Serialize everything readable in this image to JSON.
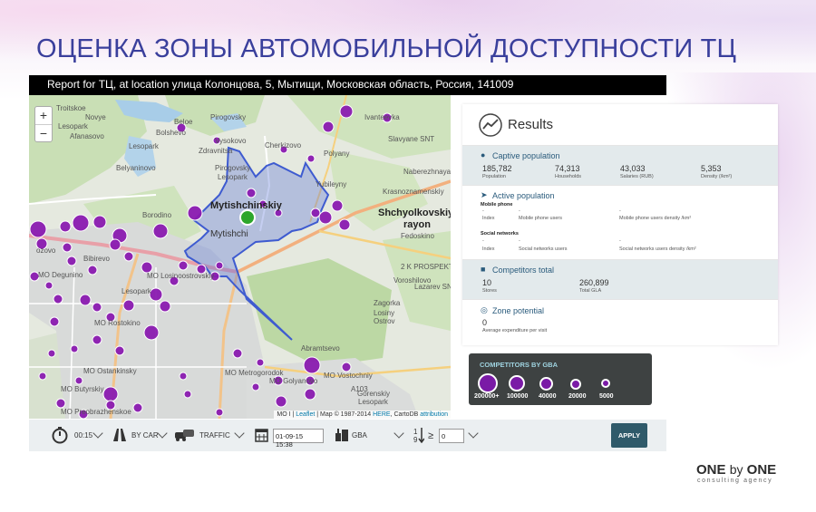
{
  "slide": {
    "title": "ОЦЕНКА ЗОНЫ АВТОМОБИЛЬНОЙ ДОСТУПНОСТИ ТЦ",
    "report": "Report for ТЦ, at location улица Колонцова, 5, Мытищи, Московская область, Россия, 141009",
    "brand": {
      "one_a": "ONE",
      "by": "by",
      "one_b": "ONE",
      "tagline": "consulting agency"
    }
  },
  "map": {
    "zoom_in": "+",
    "zoom_out": "−",
    "labels": {
      "troitskoe": "Troitskoe",
      "novye": "Novye",
      "lesopark1": "Lesopark",
      "afanasovo": "Afanasovo",
      "pirogovsky": "Pirogovsky",
      "beloe": "Beloe",
      "ivanteevka": "Ivanteevka",
      "bolshevo": "Bolshevo",
      "bolshevo2": "Bolshevo",
      "bolshevo3": "Bolshevo",
      "bolshevo4": "Bolshevo",
      "slavyane": "Slavyane SNT",
      "lesopark2": "Lesopark",
      "vysokovo": "Vysokovo",
      "cherkizovo": "Cherkizovo",
      "bolshevo5": "Bolshevo",
      "bolshevo6": "Bolshevo",
      "zdravnitsa": "Zdravnitsa",
      "beluyatsko": "Beluyatsko",
      "poiyany": "Polyany",
      "lesopark3": "Lesopark",
      "belyaninovo": "Belyaninovo",
      "pirogovsky2": "Pirogovsky",
      "nabereshnaya": "Naberezhnaya",
      "lesopark4": "Lesopark",
      "yubileyny": "Yubileyny",
      "lesopark5": "Lesopark",
      "mytishchinskiy": "Mytishchinskiy",
      "krasnoznamensky": "Krasnoznamenskiy",
      "borodino": "Borodino",
      "vanino": "Vanino",
      "shchyolkovsky": "Shchyolkovskiy",
      "rayon": "rayon",
      "fedoskino": "Fedoskino",
      "mytishchi": "Mytishchi",
      "ozovo": "ozovo",
      "bibirevo": "Bibirevo",
      "mo_degunino": "MO Degunino",
      "vostochnoe": "Vostochnoe",
      "mo_losinoostrovskiy": "MO Losinoostrovskiy",
      "lesopark6": "Lesopark",
      "voroshilovo": "Voroshilovo",
      "v2kp": "2 K PROSPEKT",
      "lazarev": "Lazarev SNT",
      "zagorka": "Zagorka",
      "losiny": "Losiny",
      "ostrov": "Ostrov",
      "mo_rostokino": "MO Rostokino",
      "abramtsevo": "Abramtsevo",
      "mo_ostankinsky": "MO Ostankinsky",
      "mo_metrogorodok": "MO Metrogorodok",
      "mo_vostochniy": "MO Vostochniy",
      "mo_butyrskiy": "MO Butyrskiy",
      "mo_golyanovo": "MO Golyanovo",
      "gorensky": "Gorenskiy",
      "lesopark7": "Lesopark",
      "mo_preobrazhenskoe": "MO Preobrazhenskoe",
      "mo_i": "MO I",
      "ulitsa": "ulitsa",
      "a103": "A103"
    },
    "attribution": {
      "leaflet": "Leaflet",
      "map": "Map © 1987-2014",
      "here": "HERE",
      "cartodb": "CartoDB",
      "attr": "attribution"
    }
  },
  "results": {
    "title": "Results",
    "captive": {
      "title": "Captive population",
      "items": [
        {
          "value": "185,782",
          "caption": "Population"
        },
        {
          "value": "74,313",
          "caption": "Households"
        },
        {
          "value": "43,033",
          "caption": "Salaries (RUB)"
        },
        {
          "value": "5,353",
          "caption": "Density (/km²)"
        }
      ]
    },
    "active": {
      "title": "Active population",
      "mobile_label": "Mobile phone",
      "mobile": [
        {
          "value": "-",
          "caption": "Index"
        },
        {
          "value": "-",
          "caption": "Mobile phone users"
        },
        {
          "value": "-",
          "caption": "Mobile phone users density /km²"
        }
      ],
      "social_label": "Social networks",
      "social": [
        {
          "value": "-",
          "caption": "Index"
        },
        {
          "value": "-",
          "caption": "Social networks users"
        },
        {
          "value": "-",
          "caption": "Social networks users density /km²"
        }
      ]
    },
    "competitors": {
      "title": "Competitors total",
      "items": [
        {
          "value": "10",
          "caption": "Stores"
        },
        {
          "value": "260,899",
          "caption": "Total GLA"
        }
      ]
    },
    "zone": {
      "title": "Zone potential",
      "value": "0",
      "caption": "Average expenditure per visit"
    }
  },
  "legend": {
    "title": "COMPETITORS BY GBA",
    "items": [
      "200000+",
      "100000",
      "40000",
      "20000",
      "5000"
    ]
  },
  "toolbar": {
    "time": "00:15",
    "mode": "BY CAR",
    "traffic": "TRAFFIC",
    "date": "01-09-15 15:38",
    "metric": "GBA",
    "gte": "≥",
    "threshold": "0",
    "apply": "APPLY"
  },
  "colors": {
    "title": "#3a3f9c",
    "marker": "#8a1ab0",
    "zone": "#4a63d6",
    "apply": "#2f5a6a"
  }
}
